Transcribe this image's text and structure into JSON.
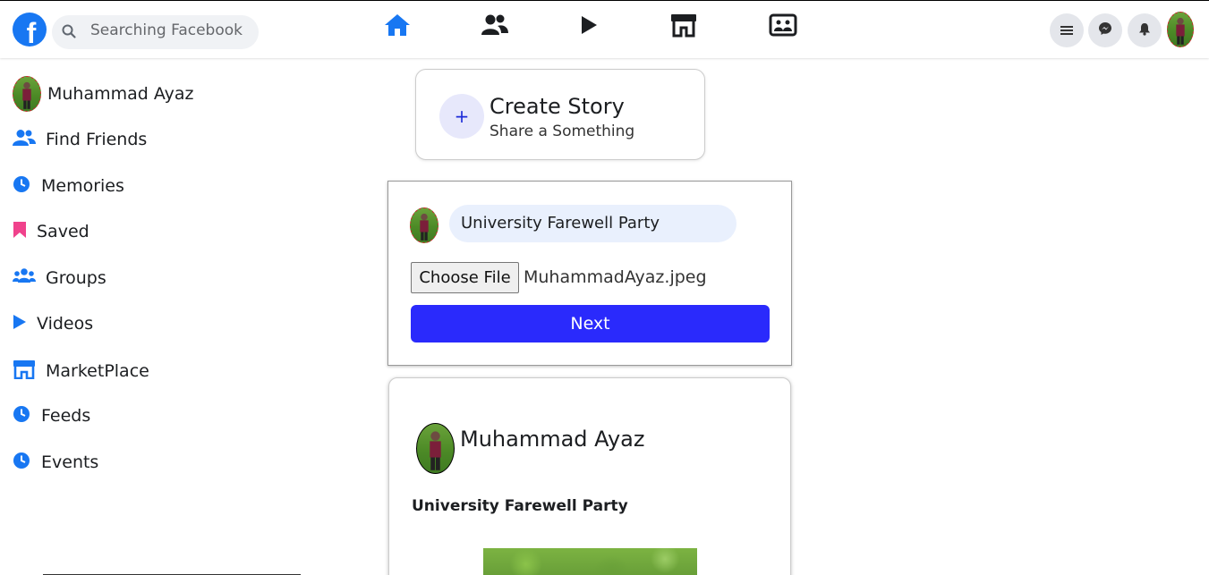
{
  "header": {
    "logo_letter": "f",
    "search_placeholder": "Searching Facebook",
    "nav_icons": [
      "home-icon",
      "friends-icon",
      "video-play-icon",
      "marketplace-icon",
      "gaming-icon"
    ],
    "right_icons": [
      "menu-icon",
      "messenger-icon",
      "bell-icon"
    ],
    "accent_color": "#1877f2"
  },
  "sidebar": {
    "items": [
      {
        "label": "Muhammad Ayaz",
        "icon": "avatar"
      },
      {
        "label": "Find Friends",
        "icon": "friends-icon"
      },
      {
        "label": "Memories",
        "icon": "clock-icon"
      },
      {
        "label": "Saved",
        "icon": "bookmark-icon"
      },
      {
        "label": "Groups",
        "icon": "groups-icon"
      },
      {
        "label": "Videos",
        "icon": "play-icon"
      },
      {
        "label": "MarketPlace",
        "icon": "store-icon"
      },
      {
        "label": "Feeds",
        "icon": "clock-icon"
      },
      {
        "label": "Events",
        "icon": "clock-icon"
      }
    ]
  },
  "story": {
    "plus": "+",
    "title": "Create Story",
    "subtitle": "Share a Something"
  },
  "composer": {
    "status_text": "University Farewell Party",
    "choose_file_label": "Choose File",
    "file_name": "MuhammadAyaz.jpeg",
    "next_label": "Next",
    "next_color": "#2a2afc"
  },
  "post": {
    "author": "Muhammad Ayaz",
    "text": "University Farewell Party"
  }
}
